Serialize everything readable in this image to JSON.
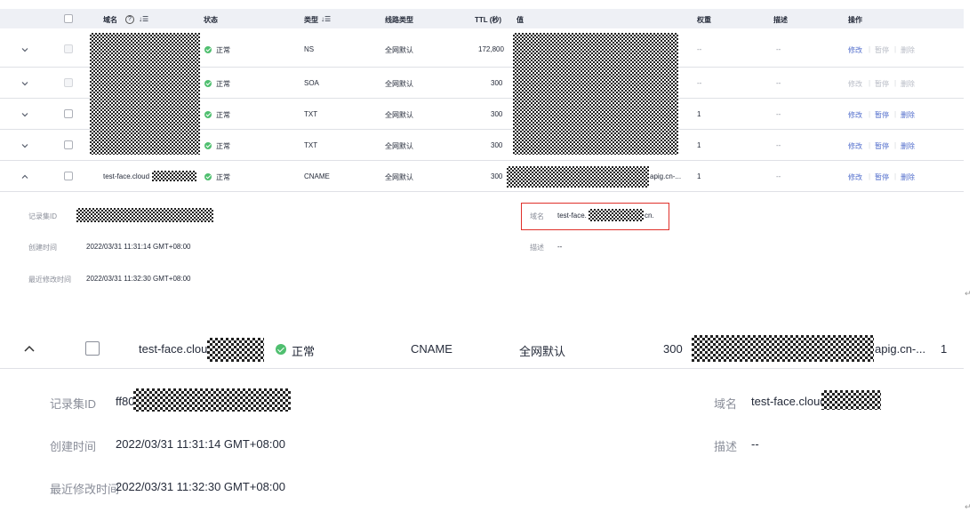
{
  "table": {
    "headers": {
      "domain": "域名",
      "help_icon": "?",
      "sort_icon": "↓☰",
      "status": "状态",
      "type": "类型",
      "line_type": "线路类型",
      "ttl": "TTL (秒)",
      "value": "值",
      "weight": "权重",
      "description": "描述",
      "actions": "操作"
    },
    "rows": [
      {
        "status": "正常",
        "type": "NS",
        "line": "全网默认",
        "ttl": "172,800",
        "weight": "--",
        "desc": "--",
        "edit": "修改",
        "pause": "暂停",
        "delete": "删除"
      },
      {
        "status": "正常",
        "type": "SOA",
        "line": "全网默认",
        "ttl": "300",
        "weight": "--",
        "desc": "--",
        "edit": "修改",
        "pause": "暂停",
        "delete": "删除"
      },
      {
        "status": "正常",
        "type": "TXT",
        "line": "全网默认",
        "ttl": "300",
        "weight": "1",
        "desc": "--",
        "edit": "修改",
        "pause": "暂停",
        "delete": "删除"
      },
      {
        "status": "正常",
        "type": "TXT",
        "line": "全网默认",
        "ttl": "300",
        "weight": "1",
        "desc": "--",
        "edit": "修改",
        "pause": "暂停",
        "delete": "删除"
      },
      {
        "domain": "test-face.cloud",
        "status": "正常",
        "type": "CNAME",
        "line": "全网默认",
        "ttl": "300",
        "value_suffix": "apig.cn-...",
        "weight": "1",
        "desc": "--",
        "edit": "修改",
        "pause": "暂停",
        "delete": "删除"
      }
    ],
    "detail": {
      "record_id_label": "记录集ID",
      "created_label": "创建时间",
      "created_value": "2022/03/31 11:31:14 GMT+08:00",
      "modified_label": "最近修改时间",
      "modified_value": "2022/03/31 11:32:30 GMT+08:00",
      "domain_label": "域名",
      "domain_value_prefix": "test-face.",
      "domain_value_suffix": "cn.",
      "desc_label": "描述",
      "desc_value": "--"
    }
  },
  "zoomed": {
    "domain": "test-face.cloud",
    "status": "正常",
    "type": "CNAME",
    "line": "全网默认",
    "ttl": "300",
    "value_suffix": "apig.cn-...",
    "weight": "1",
    "record_id_label": "记录集ID",
    "record_id_prefix": "ff80",
    "created_label": "创建时间",
    "created_value": "2022/03/31 11:31:14 GMT+08:00",
    "modified_label": "最近修改时间",
    "modified_value": "2022/03/31 11:32:30 GMT+08:00",
    "domain_label": "域名",
    "domain_value": "test-face.cloud",
    "desc_label": "描述",
    "desc_value": "--"
  },
  "paragraph_mark": "↵",
  "colors": {
    "accent": "#526ecc",
    "success": "#4fbf6f",
    "highlight": "#e0302a"
  }
}
